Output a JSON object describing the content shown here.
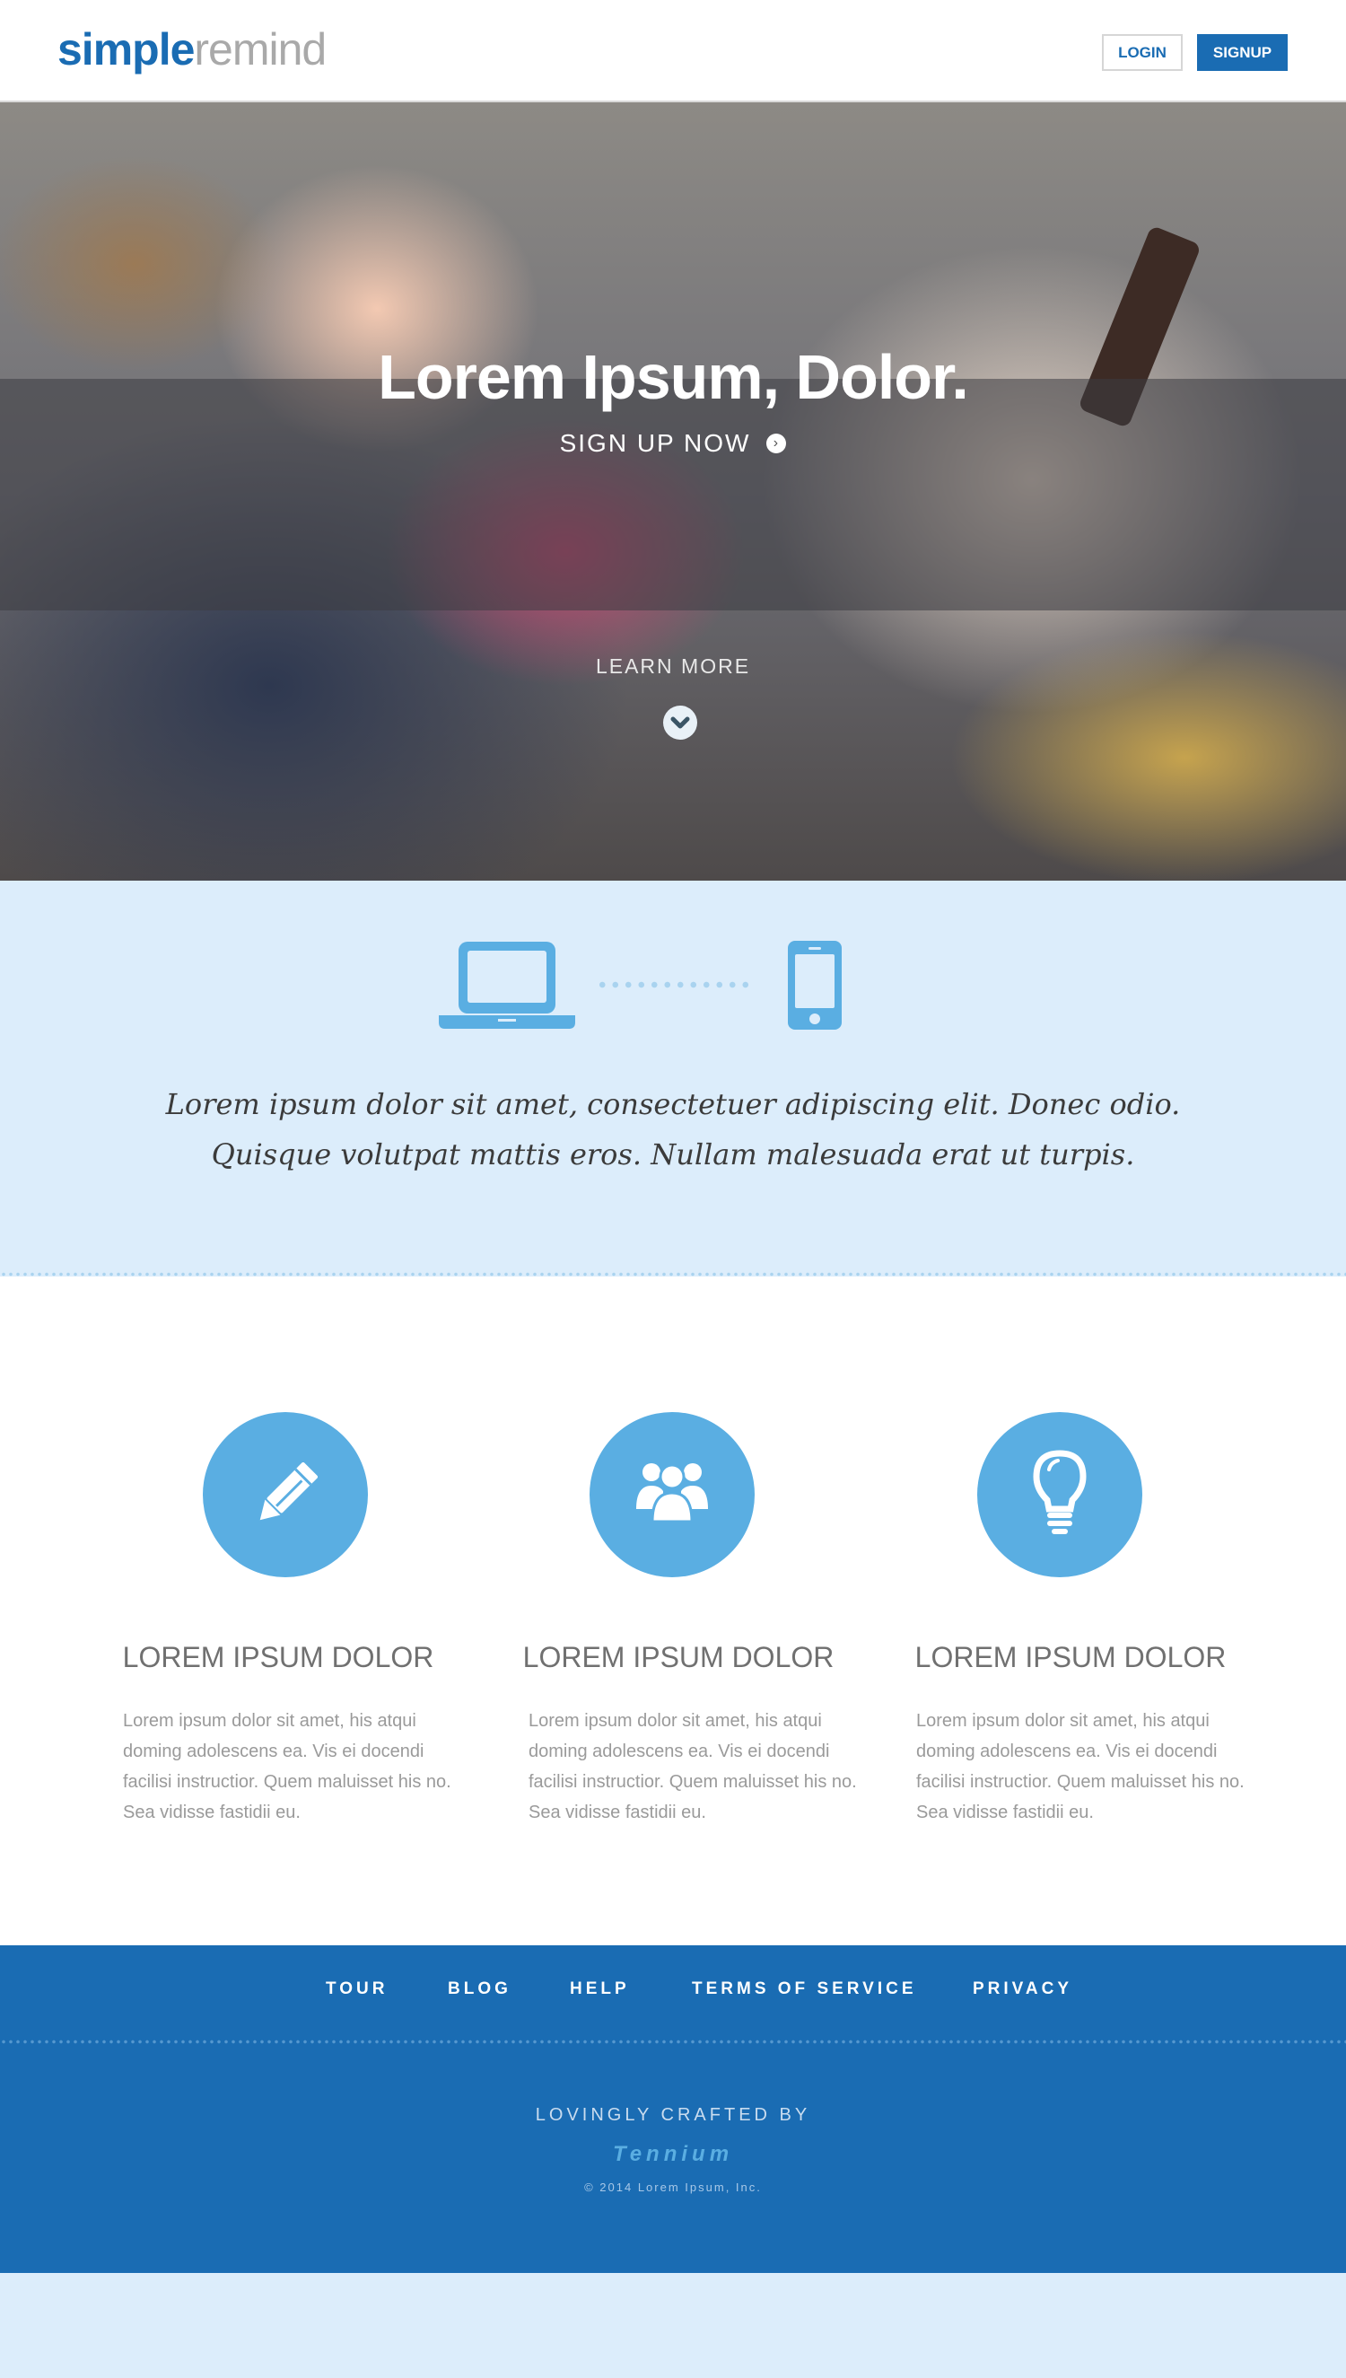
{
  "header": {
    "logo_primary": "simple",
    "logo_secondary": "remind",
    "login_label": "LOGIN",
    "signup_label": "SIGNUP"
  },
  "hero": {
    "title": "Lorem Ipsum, Dolor.",
    "cta_label": "SIGN UP NOW",
    "learn_more_label": "LEARN MORE"
  },
  "intro": {
    "text": "Lorem ipsum dolor sit amet, consectetuer adipiscing elit. Donec odio. Quisque volutpat mattis eros. Nullam malesuada erat ut turpis."
  },
  "features": [
    {
      "icon": "pencil-icon",
      "title": "LOREM IPSUM DOLOR",
      "text": "Lorem ipsum dolor sit amet, his atqui doming adolescens ea. Vis ei docendi facilisi instructior. Quem maluisset his no. Sea vidisse fastidii eu."
    },
    {
      "icon": "users-icon",
      "title": "LOREM IPSUM DOLOR",
      "text": "Lorem ipsum dolor sit amet, his atqui doming adolescens ea. Vis ei docendi facilisi instructior. Quem maluisset his no. Sea vidisse fastidii eu."
    },
    {
      "icon": "lightbulb-icon",
      "title": "LOREM IPSUM DOLOR",
      "text": "Lorem ipsum dolor sit amet, his atqui doming adolescens ea. Vis ei docendi facilisi instructior. Quem maluisset his no. Sea vidisse fastidii eu."
    }
  ],
  "footer": {
    "nav": [
      "TOUR",
      "BLOG",
      "HELP",
      "TERMS OF SERVICE",
      "PRIVACY"
    ],
    "crafted_by": "LOVINGLY CRAFTED BY",
    "brand": "Tennium",
    "copyright": "© 2014 Lorem Ipsum, Inc."
  },
  "colors": {
    "brand_blue": "#1a6cb3",
    "icon_blue": "#5aaee2",
    "light_band": "#dcedfb"
  }
}
